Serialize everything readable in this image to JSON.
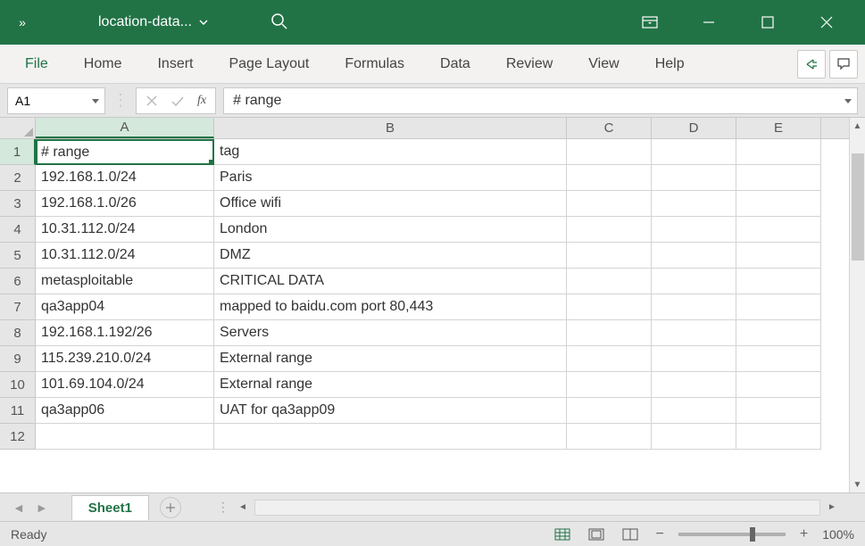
{
  "titlebar": {
    "filename": "location-data...",
    "chevron_left": "»"
  },
  "ribbon": {
    "tabs": [
      "File",
      "Home",
      "Insert",
      "Page Layout",
      "Formulas",
      "Data",
      "Review",
      "View",
      "Help"
    ]
  },
  "formulaBar": {
    "cellRef": "A1",
    "fxLabel": "fx",
    "value": "# range"
  },
  "grid": {
    "columns": [
      "A",
      "B",
      "C",
      "D",
      "E"
    ],
    "rows": [
      {
        "n": 1,
        "A": "# range",
        "B": "tag"
      },
      {
        "n": 2,
        "A": "192.168.1.0/24",
        "B": "Paris"
      },
      {
        "n": 3,
        "A": "192.168.1.0/26",
        "B": "Office wifi"
      },
      {
        "n": 4,
        "A": "10.31.112.0/24",
        "B": "London"
      },
      {
        "n": 5,
        "A": "10.31.112.0/24",
        "B": "DMZ"
      },
      {
        "n": 6,
        "A": "metasploitable",
        "B": "CRITICAL DATA"
      },
      {
        "n": 7,
        "A": "qa3app04",
        "B": "mapped to baidu.com port 80,443"
      },
      {
        "n": 8,
        "A": "192.168.1.192/26",
        "B": "Servers"
      },
      {
        "n": 9,
        "A": "115.239.210.0/24",
        "B": "External range"
      },
      {
        "n": 10,
        "A": "101.69.104.0/24",
        "B": "External range"
      },
      {
        "n": 11,
        "A": "qa3app06",
        "B": "UAT for qa3app09"
      },
      {
        "n": 12,
        "A": "",
        "B": ""
      }
    ],
    "selectedCell": "A1"
  },
  "sheets": {
    "active": "Sheet1"
  },
  "status": {
    "text": "Ready",
    "zoom": "100%"
  }
}
